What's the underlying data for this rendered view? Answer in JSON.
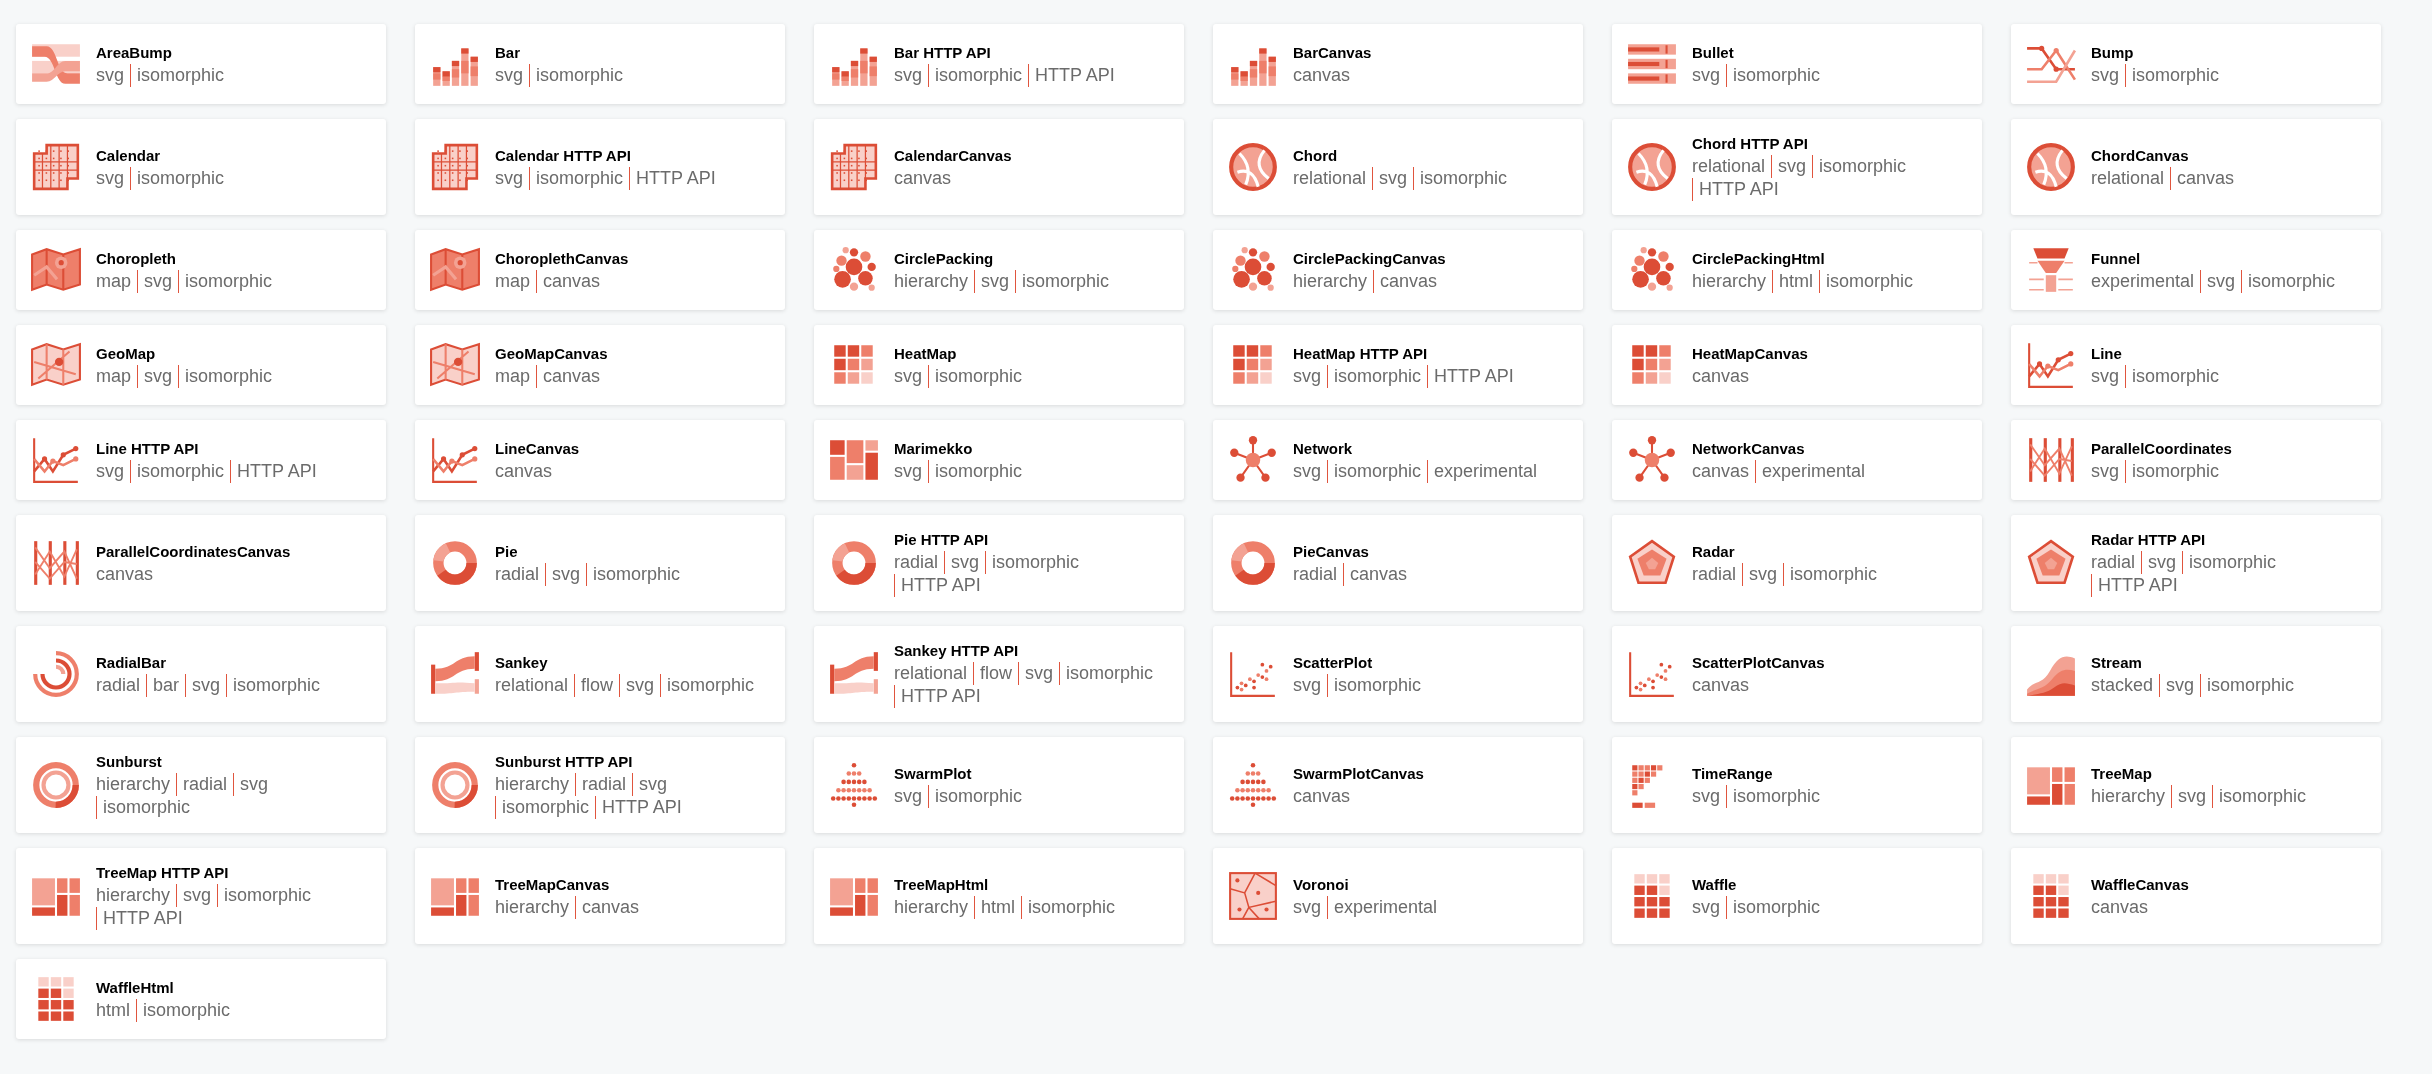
{
  "cards": [
    {
      "title": "AreaBump",
      "kind": "area_bump",
      "tags": [
        "svg",
        "isomorphic"
      ]
    },
    {
      "title": "Bar",
      "kind": "bar",
      "tags": [
        "svg",
        "isomorphic"
      ]
    },
    {
      "title": "Bar HTTP API",
      "kind": "bar",
      "tags": [
        "svg",
        "isomorphic",
        "HTTP API"
      ]
    },
    {
      "title": "BarCanvas",
      "kind": "bar",
      "tags": [
        "canvas"
      ]
    },
    {
      "title": "Bullet",
      "kind": "bullet",
      "tags": [
        "svg",
        "isomorphic"
      ]
    },
    {
      "title": "Bump",
      "kind": "bump",
      "tags": [
        "svg",
        "isomorphic"
      ]
    },
    {
      "title": "Calendar",
      "kind": "calendar",
      "tags": [
        "svg",
        "isomorphic"
      ]
    },
    {
      "title": "Calendar HTTP API",
      "kind": "calendar",
      "tags": [
        "svg",
        "isomorphic",
        "HTTP API"
      ]
    },
    {
      "title": "CalendarCanvas",
      "kind": "calendar",
      "tags": [
        "canvas"
      ]
    },
    {
      "title": "Chord",
      "kind": "chord",
      "tags": [
        "relational",
        "svg",
        "isomorphic"
      ]
    },
    {
      "title": "Chord HTTP API",
      "kind": "chord",
      "tags": [
        "relational",
        "svg",
        "isomorphic",
        "HTTP API"
      ]
    },
    {
      "title": "ChordCanvas",
      "kind": "chord",
      "tags": [
        "relational",
        "canvas"
      ]
    },
    {
      "title": "Choropleth",
      "kind": "map",
      "tags": [
        "map",
        "svg",
        "isomorphic"
      ]
    },
    {
      "title": "ChoroplethCanvas",
      "kind": "map",
      "tags": [
        "map",
        "canvas"
      ]
    },
    {
      "title": "CirclePacking",
      "kind": "circles",
      "tags": [
        "hierarchy",
        "svg",
        "isomorphic"
      ]
    },
    {
      "title": "CirclePackingCanvas",
      "kind": "circles",
      "tags": [
        "hierarchy",
        "canvas"
      ]
    },
    {
      "title": "CirclePackingHtml",
      "kind": "circles",
      "tags": [
        "hierarchy",
        "html",
        "isomorphic"
      ]
    },
    {
      "title": "Funnel",
      "kind": "funnel",
      "tags": [
        "experimental",
        "svg",
        "isomorphic"
      ]
    },
    {
      "title": "GeoMap",
      "kind": "geomap",
      "tags": [
        "map",
        "svg",
        "isomorphic"
      ]
    },
    {
      "title": "GeoMapCanvas",
      "kind": "geomap",
      "tags": [
        "map",
        "canvas"
      ]
    },
    {
      "title": "HeatMap",
      "kind": "heatmap",
      "tags": [
        "svg",
        "isomorphic"
      ]
    },
    {
      "title": "HeatMap HTTP API",
      "kind": "heatmap",
      "tags": [
        "svg",
        "isomorphic",
        "HTTP API"
      ]
    },
    {
      "title": "HeatMapCanvas",
      "kind": "heatmap",
      "tags": [
        "canvas"
      ]
    },
    {
      "title": "Line",
      "kind": "line",
      "tags": [
        "svg",
        "isomorphic"
      ]
    },
    {
      "title": "Line HTTP API",
      "kind": "line",
      "tags": [
        "svg",
        "isomorphic",
        "HTTP API"
      ]
    },
    {
      "title": "LineCanvas",
      "kind": "line",
      "tags": [
        "canvas"
      ]
    },
    {
      "title": "Marimekko",
      "kind": "marimekko",
      "tags": [
        "svg",
        "isomorphic"
      ]
    },
    {
      "title": "Network",
      "kind": "network",
      "tags": [
        "svg",
        "isomorphic",
        "experimental"
      ]
    },
    {
      "title": "NetworkCanvas",
      "kind": "network",
      "tags": [
        "canvas",
        "experimental"
      ]
    },
    {
      "title": "ParallelCoordinates",
      "kind": "parallel",
      "tags": [
        "svg",
        "isomorphic"
      ]
    },
    {
      "title": "ParallelCoordinatesCanvas",
      "kind": "parallel",
      "tags": [
        "canvas"
      ]
    },
    {
      "title": "Pie",
      "kind": "pie",
      "tags": [
        "radial",
        "svg",
        "isomorphic"
      ]
    },
    {
      "title": "Pie HTTP API",
      "kind": "pie",
      "tags": [
        "radial",
        "svg",
        "isomorphic",
        "HTTP API"
      ]
    },
    {
      "title": "PieCanvas",
      "kind": "pie",
      "tags": [
        "radial",
        "canvas"
      ]
    },
    {
      "title": "Radar",
      "kind": "radar",
      "tags": [
        "radial",
        "svg",
        "isomorphic"
      ]
    },
    {
      "title": "Radar HTTP API",
      "kind": "radar",
      "tags": [
        "radial",
        "svg",
        "isomorphic",
        "HTTP API"
      ]
    },
    {
      "title": "RadialBar",
      "kind": "radial_bar",
      "tags": [
        "radial",
        "bar",
        "svg",
        "isomorphic"
      ]
    },
    {
      "title": "Sankey",
      "kind": "sankey",
      "tags": [
        "relational",
        "flow",
        "svg",
        "isomorphic"
      ]
    },
    {
      "title": "Sankey HTTP API",
      "kind": "sankey",
      "tags": [
        "relational",
        "flow",
        "svg",
        "isomorphic",
        "HTTP API"
      ]
    },
    {
      "title": "ScatterPlot",
      "kind": "scatter",
      "tags": [
        "svg",
        "isomorphic"
      ]
    },
    {
      "title": "ScatterPlotCanvas",
      "kind": "scatter",
      "tags": [
        "canvas"
      ]
    },
    {
      "title": "Stream",
      "kind": "stream",
      "tags": [
        "stacked",
        "svg",
        "isomorphic"
      ]
    },
    {
      "title": "Sunburst",
      "kind": "sunburst",
      "tags": [
        "hierarchy",
        "radial",
        "svg",
        "isomorphic"
      ]
    },
    {
      "title": "Sunburst HTTP API",
      "kind": "sunburst",
      "tags": [
        "hierarchy",
        "radial",
        "svg",
        "isomorphic",
        "HTTP API"
      ]
    },
    {
      "title": "SwarmPlot",
      "kind": "swarm",
      "tags": [
        "svg",
        "isomorphic"
      ]
    },
    {
      "title": "SwarmPlotCanvas",
      "kind": "swarm",
      "tags": [
        "canvas"
      ]
    },
    {
      "title": "TimeRange",
      "kind": "time_range",
      "tags": [
        "svg",
        "isomorphic"
      ]
    },
    {
      "title": "TreeMap",
      "kind": "treemap",
      "tags": [
        "hierarchy",
        "svg",
        "isomorphic"
      ]
    },
    {
      "title": "TreeMap HTTP API",
      "kind": "treemap",
      "tags": [
        "hierarchy",
        "svg",
        "isomorphic",
        "HTTP API"
      ]
    },
    {
      "title": "TreeMapCanvas",
      "kind": "treemap",
      "tags": [
        "hierarchy",
        "canvas"
      ]
    },
    {
      "title": "TreeMapHtml",
      "kind": "treemap",
      "tags": [
        "hierarchy",
        "html",
        "isomorphic"
      ]
    },
    {
      "title": "Voronoi",
      "kind": "voronoi",
      "tags": [
        "svg",
        "experimental"
      ]
    },
    {
      "title": "Waffle",
      "kind": "waffle",
      "tags": [
        "svg",
        "isomorphic"
      ]
    },
    {
      "title": "WaffleCanvas",
      "kind": "waffle",
      "tags": [
        "canvas"
      ]
    },
    {
      "title": "WaffleHtml",
      "kind": "waffle",
      "tags": [
        "html",
        "isomorphic"
      ]
    }
  ]
}
